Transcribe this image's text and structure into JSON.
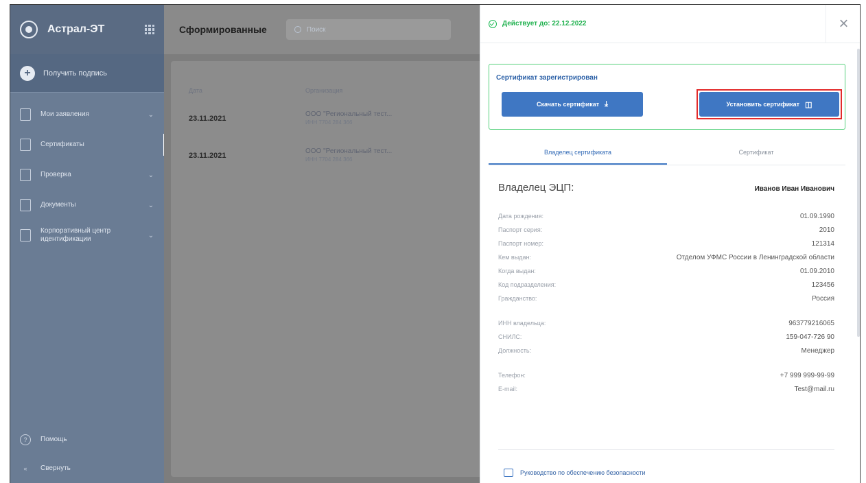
{
  "sidebar": {
    "brand": "Астрал-ЭТ",
    "get_signature": "Получить подпись",
    "items": [
      {
        "label": "Мои заявления",
        "chevron": true
      },
      {
        "label": "Сертификаты",
        "chevron": false,
        "active": true
      },
      {
        "label": "Проверка",
        "chevron": true
      },
      {
        "label": "Документы",
        "chevron": true
      },
      {
        "label": "Корпоративный центр идентификации",
        "chevron": true
      }
    ],
    "bottom": [
      {
        "label": "Помощь"
      },
      {
        "label": "Свернуть"
      }
    ]
  },
  "main": {
    "title": "Сформированные",
    "search_placeholder": "Поиск",
    "columns": [
      "Дата",
      "Организация"
    ],
    "rows": [
      {
        "date": "23.11.2021",
        "org": "ООО \"Региональный тест...",
        "inn": "ИНН 7704 284 366"
      },
      {
        "date": "23.11.2021",
        "org": "ООО \"Региональный тест...",
        "inn": "ИНН 7704 284 366"
      }
    ]
  },
  "panel": {
    "valid_until": "Действует до: 22.12.2022",
    "registered_title": "Сертификат зарегистрирован",
    "download_btn": "Скачать сертификат",
    "install_btn": "Установить сертификат",
    "tabs": [
      "Владелец сертификата",
      "Сертификат"
    ],
    "owner_label": "Владелец ЭЦП:",
    "owner_name": "Иванов Иван Иванович",
    "fields_a": [
      {
        "k": "Дата рождения:",
        "v": "01.09.1990"
      },
      {
        "k": "Паспорт серия:",
        "v": "2010"
      },
      {
        "k": "Паспорт номер:",
        "v": "121314"
      },
      {
        "k": "Кем выдан:",
        "v": "Отделом УФМС России в Ленинградской области"
      },
      {
        "k": "Когда выдан:",
        "v": "01.09.2010"
      },
      {
        "k": "Код подразделения:",
        "v": "123456"
      },
      {
        "k": "Гражданство:",
        "v": "Россия"
      }
    ],
    "fields_b": [
      {
        "k": "ИНН владельца:",
        "v": "963779216065"
      },
      {
        "k": "СНИЛС:",
        "v": "159-047-726 90"
      },
      {
        "k": "Должность:",
        "v": "Менеджер"
      }
    ],
    "fields_c": [
      {
        "k": "Телефон:",
        "v": "+7 999 999-99-99"
      },
      {
        "k": "E-mail:",
        "v": "Test@mail.ru"
      }
    ],
    "guide_link": "Руководство по обеспечению безопасности"
  }
}
